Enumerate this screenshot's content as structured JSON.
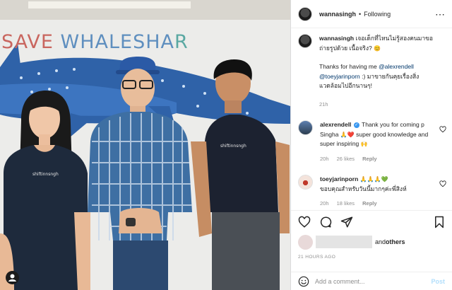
{
  "photo": {
    "wall_text_segments": [
      {
        "text": "SAVE ",
        "cls": "c0"
      },
      {
        "text": "WHALESHA",
        "cls": "c1"
      },
      {
        "text": "R",
        "cls": "c2"
      }
    ],
    "shirt_logo_left": "shiftinnsngh",
    "shirt_logo_right": "shiftinnsngh"
  },
  "header": {
    "username": "wannasingh",
    "separator": "•",
    "follow_status": "Following",
    "more_icon": "⋯"
  },
  "caption": {
    "username": "wannasingh",
    "text1": "เจอเด็กที่ไหนไม่รู้สองคนมาขอถ่ายรูปด้วย เนื้อจริง?",
    "emoji1": "😊",
    "thanks_prefix": "Thanks for having me ",
    "mention1": "@alexrendell",
    "mention2": "@toeyjarinporn",
    "thanks_suffix": " :) มาขายกันคุยเรื่องสิ่งแวดล้อมไปอีกนานๆ!",
    "time": "21h"
  },
  "comments": [
    {
      "username": "alexrendell",
      "verified_mark": "✓",
      "text": "Thank you for coming p Singha",
      "emoji_a": "🙏",
      "emoji_b": "❤️",
      "text2": " super good knowledge and super inspiring",
      "emoji_c": "🙌",
      "time": "20h",
      "likes": "26 likes",
      "reply": "Reply"
    },
    {
      "username": "toeyjarinporn",
      "emoji_a": "🙏🙏🙏",
      "emoji_b": "💚",
      "text": "ขอบคุณสำหรับวันนี้มากๆค่ะพี่สิงห์",
      "time": "20h",
      "likes": "18 likes",
      "reply": "Reply"
    }
  ],
  "footer": {
    "and_text": "and ",
    "others_text": "others",
    "time_ago": "21 HOURS AGO",
    "add_comment_placeholder": "Add a comment...",
    "post_label": "Post"
  },
  "colors": {
    "accent": "#3897f0",
    "mention": "#00376b",
    "muted": "#8e8e8e",
    "post_disabled": "#b2dffc"
  },
  "icons": {
    "like": "heart-icon",
    "comment": "comment-icon",
    "share": "share-icon",
    "save": "bookmark-icon",
    "emoji": "smiley-icon",
    "more": "more-options-icon"
  }
}
